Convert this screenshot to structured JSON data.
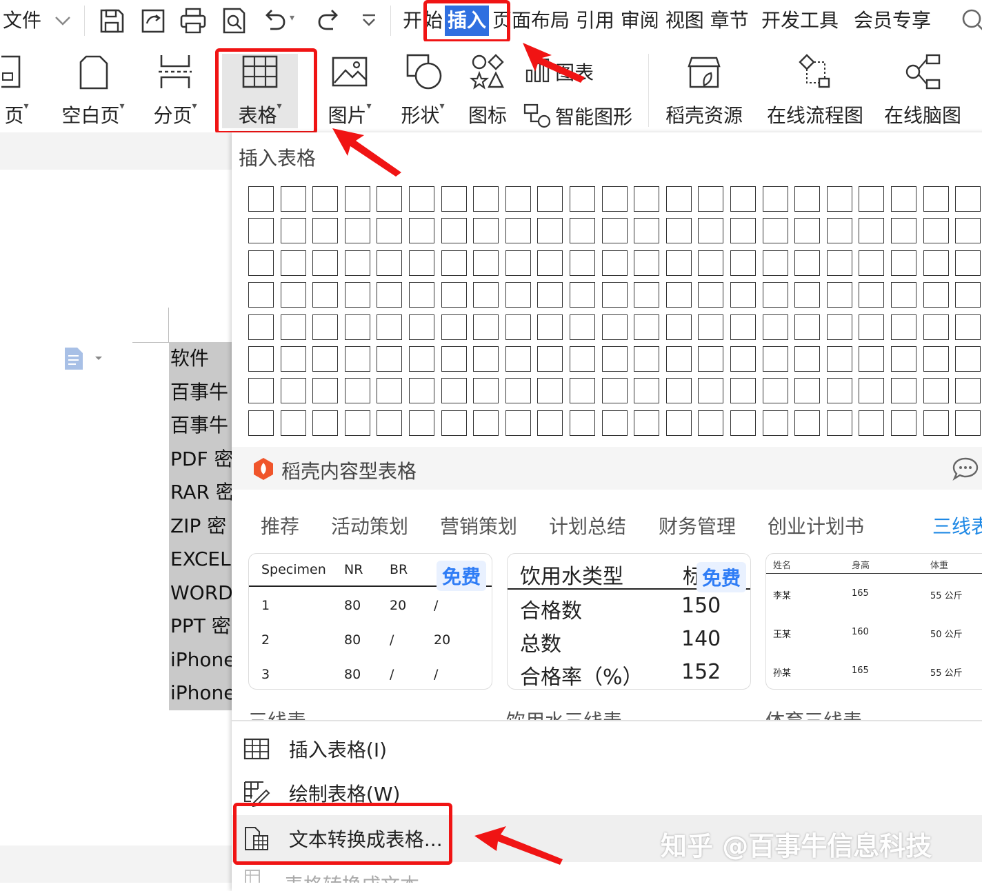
{
  "menubar": {
    "file_label": "文件",
    "tabs": [
      "开始",
      "插入",
      "页面布局",
      "引用",
      "审阅",
      "视图",
      "章节",
      "开发工具",
      "会员专享"
    ],
    "tab_kai": "开",
    "tab_shi": "始",
    "tab_insert": "插入",
    "tab_ye": "页",
    "tab_rest": "面布局 引用 审阅 视图 章节",
    "tab_dev": "开发工具",
    "tab_vip": "会员专享"
  },
  "ribbon": {
    "cover_label": "页",
    "blank_label": "空白页",
    "pagebreak_label": "分页",
    "table_label": "表格",
    "picture_label": "图片",
    "shape_label": "形状",
    "icon_label": "图标",
    "chart_label": "图表",
    "smartart_label": "智能图形",
    "resource_label": "稻壳资源",
    "flowchart_label": "在线流程图",
    "mindmap_label": "在线脑图"
  },
  "document": {
    "lines": [
      "软件 ",
      "百事牛",
      "百事牛",
      "PDF 密",
      "RAR 密",
      "ZIP 密",
      "EXCEL",
      "WORD",
      "PPT 密",
      "iPhone",
      "iPhone"
    ]
  },
  "insert_table": {
    "title": "插入表格",
    "columns": 23,
    "rows": 8
  },
  "docer": {
    "title": "稻壳内容型表格",
    "categories": [
      "推荐",
      "活动策划",
      "营销策划",
      "计划总结",
      "财务管理",
      "创业计划书",
      "三线表"
    ],
    "free_badge": "免费",
    "card1": {
      "headers": [
        "Specimen",
        "NR",
        "BR"
      ],
      "rows": [
        [
          "1",
          "80",
          "20",
          "/"
        ],
        [
          "2",
          "80",
          "/",
          "20"
        ],
        [
          "3",
          "80",
          "/",
          "/"
        ]
      ],
      "caption": "三线表"
    },
    "card2": {
      "header": "饮用水类型",
      "header_tail": "标",
      "rows": [
        [
          "合格数",
          "150"
        ],
        [
          "总数",
          "140"
        ],
        [
          "合格率（%）",
          "152"
        ]
      ],
      "caption": "饮用水三线表"
    },
    "card3": {
      "headers": [
        "姓名",
        "身高",
        "体重"
      ],
      "rows": [
        [
          "李某",
          "165",
          "55 公斤"
        ],
        [
          "王某",
          "160",
          "50 公斤"
        ],
        [
          "孙某",
          "165",
          "55 公斤"
        ]
      ],
      "caption": "体育三线表"
    }
  },
  "menu": {
    "insert_table": "插入表格(I)",
    "draw_table": "绘制表格(W)",
    "text_to_table": "文本转换成表格...",
    "table_to_text": "表格转换成文本"
  },
  "watermark": "知乎 @百事牛信息科技",
  "colors": {
    "highlight_red": "#f01414",
    "selected_tab_bg": "#2f6fe0",
    "badge_blue": "#2f7df6",
    "accent_blue": "#1e88e5"
  }
}
